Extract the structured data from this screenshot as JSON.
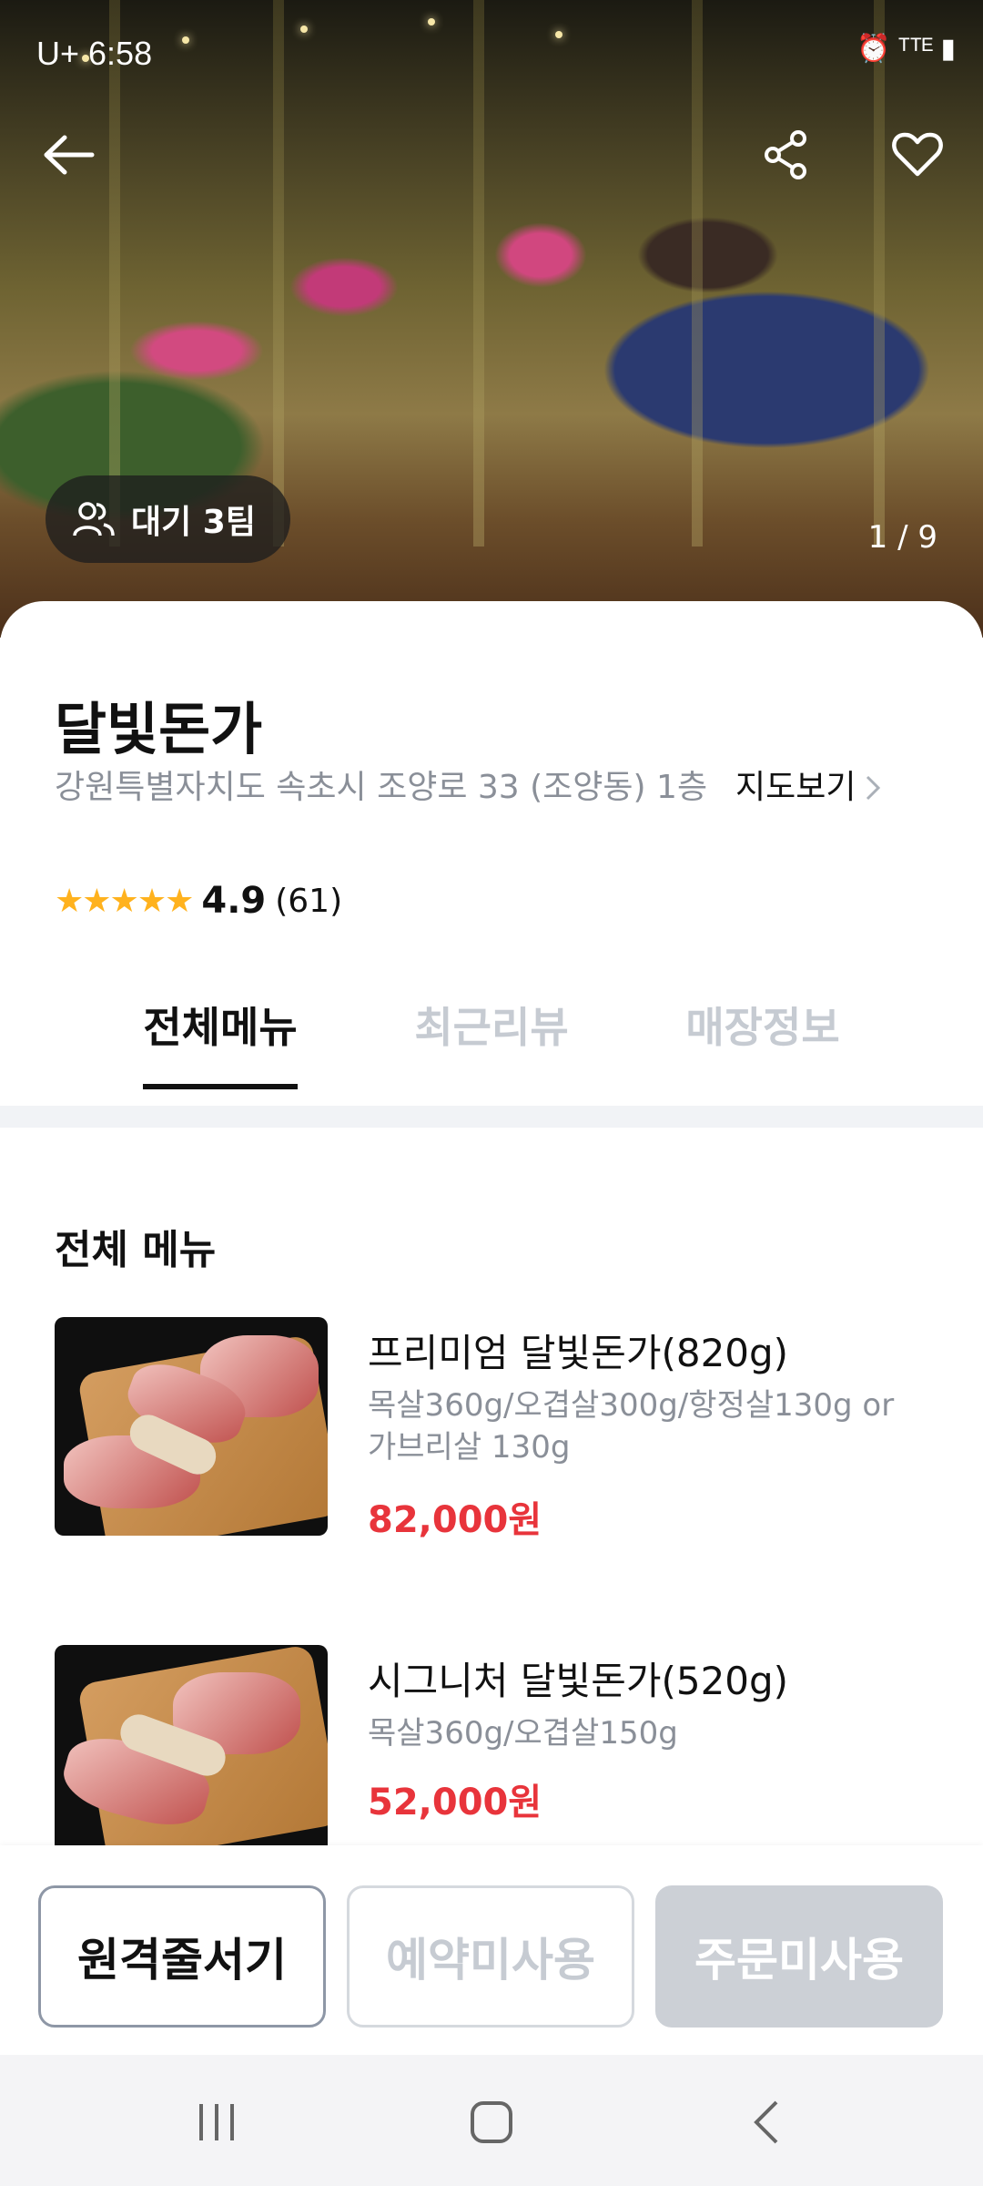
{
  "status": {
    "time": "U+ 6:58",
    "right": "⏰ ᵀᵀᴱ ▮"
  },
  "hero": {
    "wait_label": "대기 3팀",
    "pager": "1 / 9"
  },
  "store": {
    "name": "달빛돈가",
    "address": "강원특별자치도 속초시 조양로 33 (조양동) 1층",
    "map_label": "지도보기",
    "rating": "4.9",
    "review_count": "(61)",
    "stars": "★★★★★"
  },
  "tabs": [
    {
      "label": "전체메뉴",
      "active": true
    },
    {
      "label": "최근리뷰",
      "active": false
    },
    {
      "label": "매장정보",
      "active": false
    }
  ],
  "menu": {
    "section_title": "전체 메뉴",
    "items": [
      {
        "title": "프리미엄 달빛돈가(820g)",
        "desc": "목살360g/오겹살300g/항정살130g or 가브리살 130g",
        "price": "82,000원"
      },
      {
        "title": "시그니처 달빛돈가(520g)",
        "desc": "목살360g/오겹살150g",
        "price": "52,000원"
      }
    ]
  },
  "actions": {
    "remote_queue": "원격줄서기",
    "no_reservation": "예약미사용",
    "no_order": "주문미사용"
  },
  "colors": {
    "price": "#e8343b",
    "star": "#ffb21e"
  }
}
